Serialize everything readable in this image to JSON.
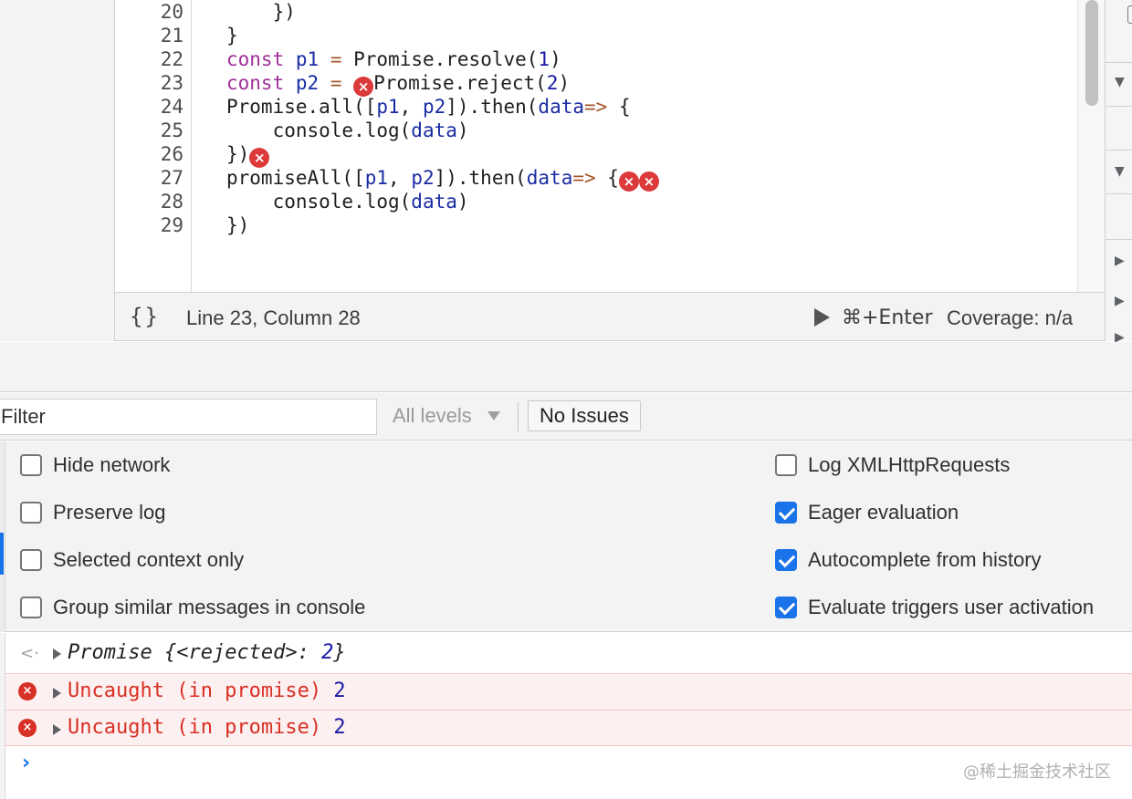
{
  "editor": {
    "lines": [
      {
        "number": "20",
        "code": "    })"
      },
      {
        "number": "21",
        "code": "}"
      },
      {
        "number": "22",
        "code": "const p1 = Promise.resolve(1)"
      },
      {
        "number": "23",
        "code": "const p2 = Promise.reject(2)"
      },
      {
        "number": "24",
        "code": "Promise.all([p1, p2]).then(data=> {"
      },
      {
        "number": "25",
        "code": "    console.log(data)"
      },
      {
        "number": "26",
        "code": "})"
      },
      {
        "number": "27",
        "code": "promiseAll([p1, p2]).then(data=> {"
      },
      {
        "number": "28",
        "code": "    console.log(data)"
      },
      {
        "number": "29",
        "code": "})"
      }
    ],
    "error_icon": "error-x-icon"
  },
  "status_bar": {
    "format_icon_label": "{}",
    "cursor_position": "Line 23, Column 28",
    "run_shortcut": "⌘+Enter",
    "coverage": "Coverage: n/a"
  },
  "toolbar": {
    "filter_placeholder": "Filter",
    "levels_label": "All levels",
    "issues_label": "No Issues"
  },
  "settings": {
    "left": [
      {
        "label": "Hide network",
        "checked": false
      },
      {
        "label": "Preserve log",
        "checked": false
      },
      {
        "label": "Selected context only",
        "checked": false
      },
      {
        "label": "Group similar messages in console",
        "checked": false
      }
    ],
    "right": [
      {
        "label": "Log XMLHttpRequests",
        "checked": false
      },
      {
        "label": "Eager evaluation",
        "checked": true
      },
      {
        "label": "Autocomplete from history",
        "checked": true
      },
      {
        "label": "Evaluate triggers user activation",
        "checked": true
      }
    ]
  },
  "console": {
    "messages": [
      {
        "type": "result",
        "prefix": "Promise ",
        "body": "{<rejected>: ",
        "value": "2",
        "suffix": "}"
      },
      {
        "type": "error",
        "text": "Uncaught (in promise) ",
        "value": "2"
      },
      {
        "type": "error",
        "text": "Uncaught (in promise) ",
        "value": "2"
      }
    ],
    "prompt_symbol": "›"
  },
  "watermark": "@稀土掘金技术社区",
  "colors": {
    "error": "#d93025",
    "accent": "#1a73e8",
    "keyword": "#a0309a",
    "variable": "#1a2ca3",
    "number": "#1a1aa6"
  }
}
